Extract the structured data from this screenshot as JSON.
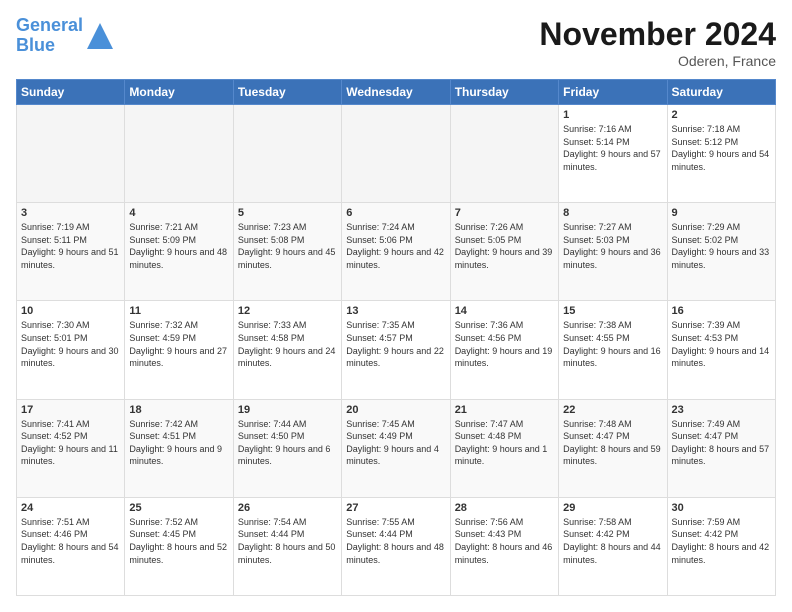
{
  "logo": {
    "line1": "General",
    "line2": "Blue"
  },
  "title": "November 2024",
  "subtitle": "Oderen, France",
  "header_days": [
    "Sunday",
    "Monday",
    "Tuesday",
    "Wednesday",
    "Thursday",
    "Friday",
    "Saturday"
  ],
  "weeks": [
    [
      {
        "day": "",
        "info": ""
      },
      {
        "day": "",
        "info": ""
      },
      {
        "day": "",
        "info": ""
      },
      {
        "day": "",
        "info": ""
      },
      {
        "day": "",
        "info": ""
      },
      {
        "day": "1",
        "info": "Sunrise: 7:16 AM\nSunset: 5:14 PM\nDaylight: 9 hours and 57 minutes."
      },
      {
        "day": "2",
        "info": "Sunrise: 7:18 AM\nSunset: 5:12 PM\nDaylight: 9 hours and 54 minutes."
      }
    ],
    [
      {
        "day": "3",
        "info": "Sunrise: 7:19 AM\nSunset: 5:11 PM\nDaylight: 9 hours and 51 minutes."
      },
      {
        "day": "4",
        "info": "Sunrise: 7:21 AM\nSunset: 5:09 PM\nDaylight: 9 hours and 48 minutes."
      },
      {
        "day": "5",
        "info": "Sunrise: 7:23 AM\nSunset: 5:08 PM\nDaylight: 9 hours and 45 minutes."
      },
      {
        "day": "6",
        "info": "Sunrise: 7:24 AM\nSunset: 5:06 PM\nDaylight: 9 hours and 42 minutes."
      },
      {
        "day": "7",
        "info": "Sunrise: 7:26 AM\nSunset: 5:05 PM\nDaylight: 9 hours and 39 minutes."
      },
      {
        "day": "8",
        "info": "Sunrise: 7:27 AM\nSunset: 5:03 PM\nDaylight: 9 hours and 36 minutes."
      },
      {
        "day": "9",
        "info": "Sunrise: 7:29 AM\nSunset: 5:02 PM\nDaylight: 9 hours and 33 minutes."
      }
    ],
    [
      {
        "day": "10",
        "info": "Sunrise: 7:30 AM\nSunset: 5:01 PM\nDaylight: 9 hours and 30 minutes."
      },
      {
        "day": "11",
        "info": "Sunrise: 7:32 AM\nSunset: 4:59 PM\nDaylight: 9 hours and 27 minutes."
      },
      {
        "day": "12",
        "info": "Sunrise: 7:33 AM\nSunset: 4:58 PM\nDaylight: 9 hours and 24 minutes."
      },
      {
        "day": "13",
        "info": "Sunrise: 7:35 AM\nSunset: 4:57 PM\nDaylight: 9 hours and 22 minutes."
      },
      {
        "day": "14",
        "info": "Sunrise: 7:36 AM\nSunset: 4:56 PM\nDaylight: 9 hours and 19 minutes."
      },
      {
        "day": "15",
        "info": "Sunrise: 7:38 AM\nSunset: 4:55 PM\nDaylight: 9 hours and 16 minutes."
      },
      {
        "day": "16",
        "info": "Sunrise: 7:39 AM\nSunset: 4:53 PM\nDaylight: 9 hours and 14 minutes."
      }
    ],
    [
      {
        "day": "17",
        "info": "Sunrise: 7:41 AM\nSunset: 4:52 PM\nDaylight: 9 hours and 11 minutes."
      },
      {
        "day": "18",
        "info": "Sunrise: 7:42 AM\nSunset: 4:51 PM\nDaylight: 9 hours and 9 minutes."
      },
      {
        "day": "19",
        "info": "Sunrise: 7:44 AM\nSunset: 4:50 PM\nDaylight: 9 hours and 6 minutes."
      },
      {
        "day": "20",
        "info": "Sunrise: 7:45 AM\nSunset: 4:49 PM\nDaylight: 9 hours and 4 minutes."
      },
      {
        "day": "21",
        "info": "Sunrise: 7:47 AM\nSunset: 4:48 PM\nDaylight: 9 hours and 1 minute."
      },
      {
        "day": "22",
        "info": "Sunrise: 7:48 AM\nSunset: 4:47 PM\nDaylight: 8 hours and 59 minutes."
      },
      {
        "day": "23",
        "info": "Sunrise: 7:49 AM\nSunset: 4:47 PM\nDaylight: 8 hours and 57 minutes."
      }
    ],
    [
      {
        "day": "24",
        "info": "Sunrise: 7:51 AM\nSunset: 4:46 PM\nDaylight: 8 hours and 54 minutes."
      },
      {
        "day": "25",
        "info": "Sunrise: 7:52 AM\nSunset: 4:45 PM\nDaylight: 8 hours and 52 minutes."
      },
      {
        "day": "26",
        "info": "Sunrise: 7:54 AM\nSunset: 4:44 PM\nDaylight: 8 hours and 50 minutes."
      },
      {
        "day": "27",
        "info": "Sunrise: 7:55 AM\nSunset: 4:44 PM\nDaylight: 8 hours and 48 minutes."
      },
      {
        "day": "28",
        "info": "Sunrise: 7:56 AM\nSunset: 4:43 PM\nDaylight: 8 hours and 46 minutes."
      },
      {
        "day": "29",
        "info": "Sunrise: 7:58 AM\nSunset: 4:42 PM\nDaylight: 8 hours and 44 minutes."
      },
      {
        "day": "30",
        "info": "Sunrise: 7:59 AM\nSunset: 4:42 PM\nDaylight: 8 hours and 42 minutes."
      }
    ]
  ]
}
